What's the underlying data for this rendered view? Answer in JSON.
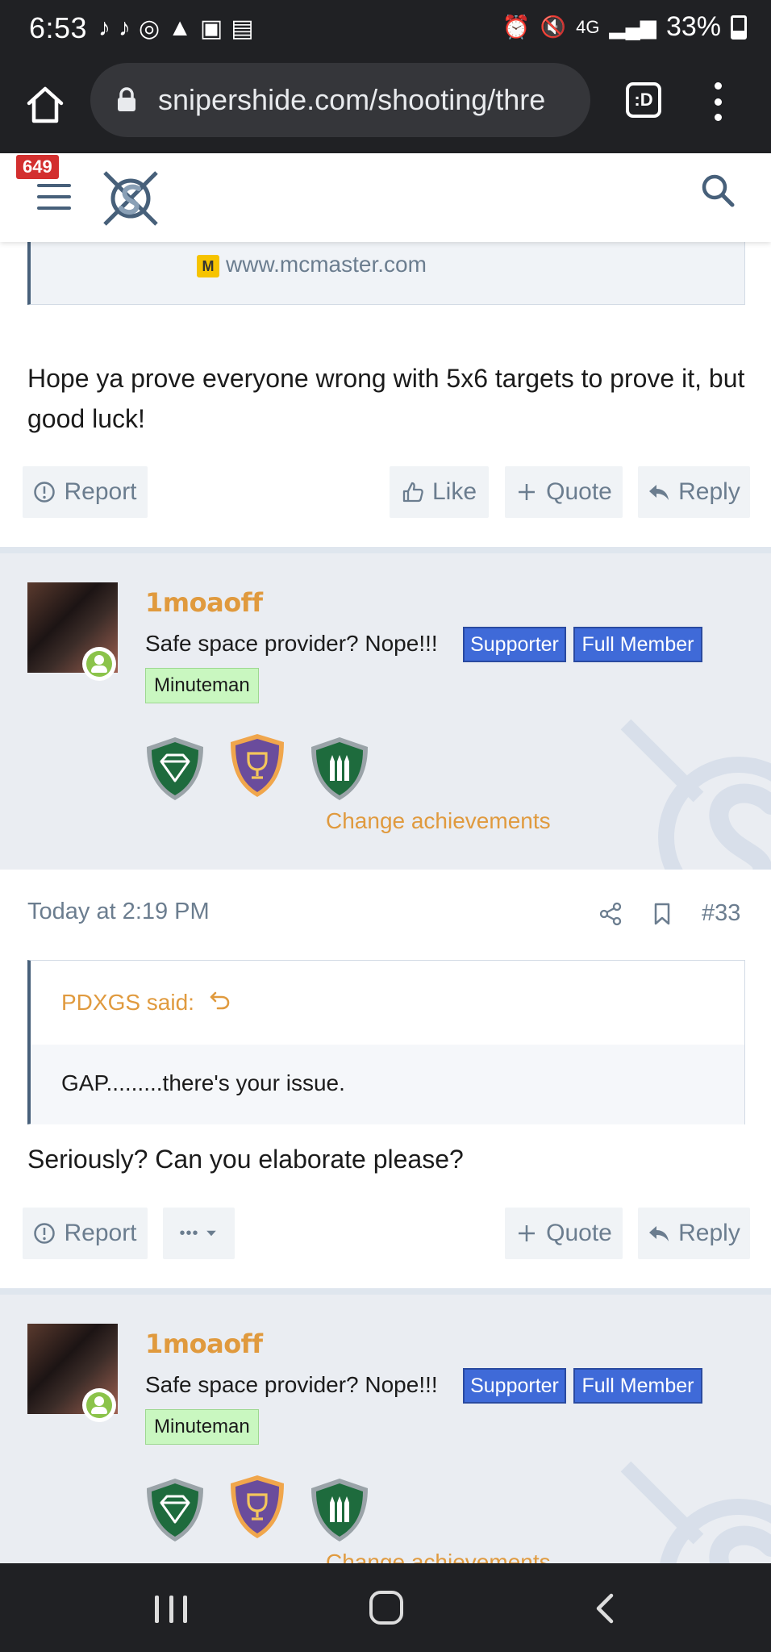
{
  "status": {
    "time": "6:53",
    "signal": "4G",
    "battery": "33%"
  },
  "browser": {
    "url": "snipershide.com/shooting/thre",
    "tabs_label": ":D"
  },
  "header": {
    "notification_count": "649"
  },
  "link_preview": {
    "favicon_letter": "M",
    "url": "www.mcmaster.com"
  },
  "post1": {
    "text": "Hope ya prove everyone wrong with 5x6 targets to prove it, but good luck!",
    "actions": {
      "report": "Report",
      "like": "Like",
      "quote": "Quote",
      "reply": "Reply"
    }
  },
  "user": {
    "name": "1moaoff",
    "title": "Safe space provider? Nope!!!",
    "banners": [
      "Supporter",
      "Full Member",
      "Minuteman"
    ],
    "change_achievements": "Change achievements"
  },
  "post2": {
    "date": "Today at 2:19 PM",
    "number": "#33",
    "quote_author": "PDXGS said:",
    "quote_text": "GAP.........there's your issue.",
    "text": "Seriously? Can you elaborate please?",
    "actions": {
      "report": "Report",
      "more": "•••",
      "quote": "Quote",
      "reply": "Reply"
    }
  },
  "colors": {
    "accent_orange": "#e09a3e",
    "banner_blue": "#3f6ad8",
    "banner_green": "#c9f7c0",
    "slate": "#47607a"
  }
}
